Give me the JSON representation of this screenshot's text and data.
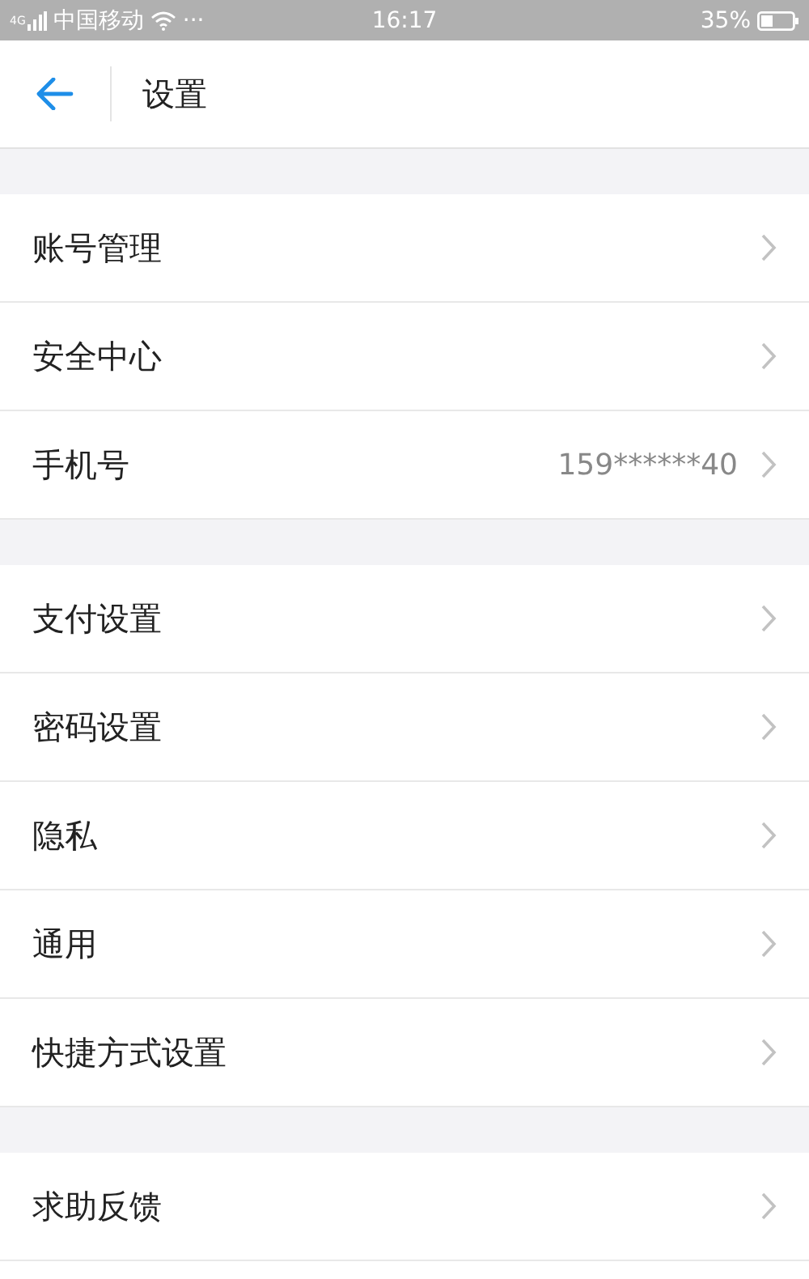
{
  "status_bar": {
    "network": "4G",
    "carrier": "中国移动",
    "more": "···",
    "time": "16:17",
    "battery": "35%"
  },
  "header": {
    "title": "设置"
  },
  "groups": [
    [
      {
        "label": "账号管理"
      },
      {
        "label": "安全中心"
      },
      {
        "label": "手机号",
        "value": "159******40"
      }
    ],
    [
      {
        "label": "支付设置"
      },
      {
        "label": "密码设置"
      },
      {
        "label": "隐私"
      },
      {
        "label": "通用"
      },
      {
        "label": "快捷方式设置"
      }
    ],
    [
      {
        "label": "求助反馈"
      }
    ]
  ]
}
